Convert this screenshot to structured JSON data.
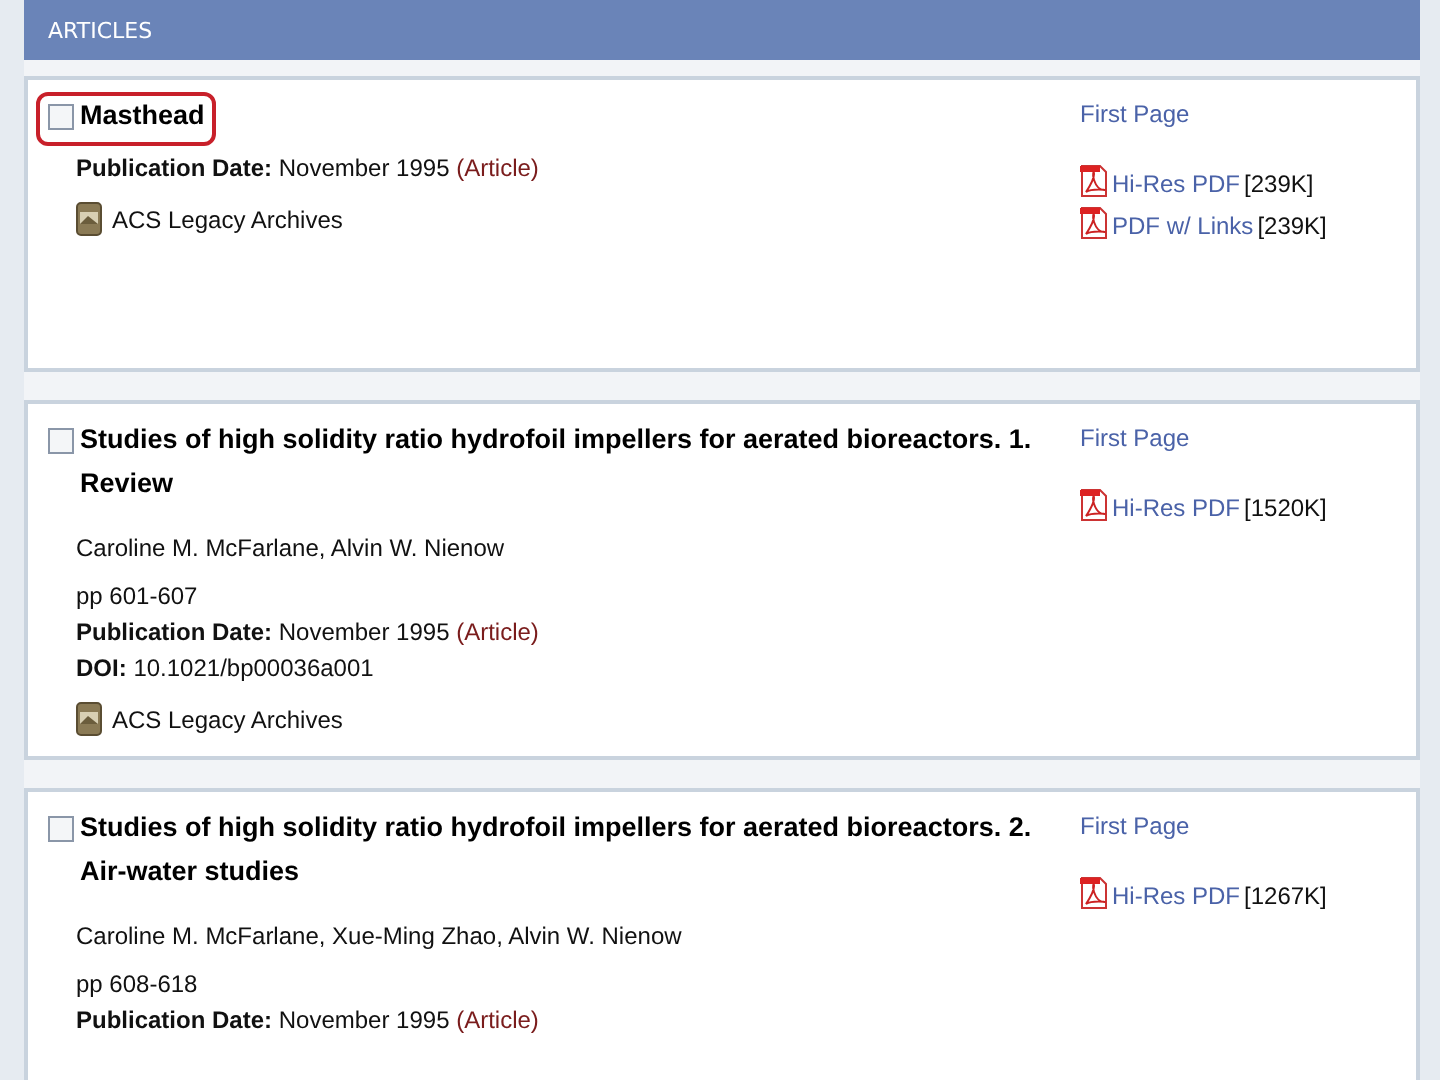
{
  "section_title": "ARTICLES",
  "articles": [
    {
      "title": "Masthead",
      "checked": false,
      "highlighted": true,
      "date_label": "Publication Date:",
      "date": "November 1995",
      "type": "(Article)",
      "archive": "ACS Legacy Archives",
      "links": [
        {
          "kind": "page",
          "label": "First Page"
        },
        {
          "kind": "pdf",
          "label": "Hi-Res PDF",
          "size": "[239K]"
        },
        {
          "kind": "pdf",
          "label": "PDF w/ Links",
          "size": "[239K]"
        }
      ]
    },
    {
      "title": "Studies of high solidity ratio hydrofoil impellers for aerated bioreactors. 1. Review",
      "checked": false,
      "highlighted": false,
      "authors": "Caroline M. McFarlane, Alvin W. Nienow",
      "pages": "pp 601-607",
      "date_label": "Publication Date:",
      "date": "November 1995",
      "type": "(Article)",
      "doi_label": "DOI:",
      "doi": "10.1021/bp00036a001",
      "archive": "ACS Legacy Archives",
      "links": [
        {
          "kind": "page",
          "label": "First Page"
        },
        {
          "kind": "pdf",
          "label": "Hi-Res PDF",
          "size": "[1520K]"
        }
      ]
    },
    {
      "title": "Studies of high solidity ratio hydrofoil impellers for aerated bioreactors. 2. Air-water studies",
      "checked": false,
      "highlighted": false,
      "authors": "Caroline M. McFarlane, Xue-Ming Zhao, Alvin W. Nienow",
      "pages": "pp 608-618",
      "date_label": "Publication Date:",
      "date": "November 1995",
      "type": "(Article)",
      "links": [
        {
          "kind": "page",
          "label": "First Page"
        },
        {
          "kind": "pdf",
          "label": "Hi-Res PDF",
          "size": "[1267K]"
        }
      ]
    }
  ]
}
